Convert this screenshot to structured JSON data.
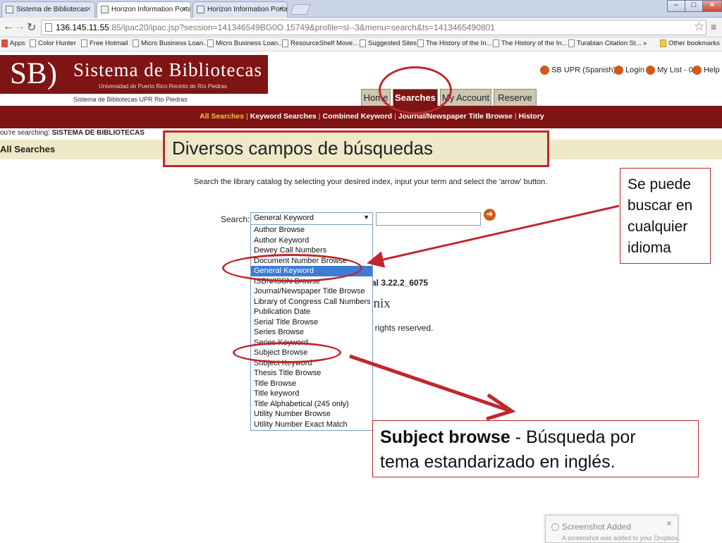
{
  "browser": {
    "tabs": [
      {
        "label": "Sistema de Bibliotecas"
      },
      {
        "label": "Horizon Information Porta"
      },
      {
        "label": "Horizon Information Porta"
      }
    ],
    "url_host": "136.145.11.55",
    "url_rest": ":85/ipac20/ipac.jsp?session=141346549BG0O.15749&profile=sl--3&menu=search&ts=1413465490801",
    "bookmarks": [
      "Apps",
      "Color Hunter",
      "Free Hotmail",
      "Micro Business Loan...",
      "Micro Business Loan...",
      "ResourceShelf Move...",
      "Suggested Sites",
      "The History of the In...",
      "The History of the In...",
      "Turabian Citation St...",
      "»",
      "Other bookmarks"
    ]
  },
  "library": {
    "logo_sb": "SB)",
    "logo_title": "Sistema de Bibliotecas",
    "logo_sub": "Universidad de Puerto Rico Recinto de Río Piedras",
    "logo_caption": "Sistema de Bibliotecas UPR Rio Piedras",
    "top_links": {
      "lang": "SB UPR (Spanish)",
      "login": "Login",
      "mylist": "My List - 0",
      "help": "Help"
    },
    "tabs": [
      "Home",
      "Searches",
      "My Account",
      "Reserve"
    ],
    "sublinks": [
      "All Searches",
      "Keyword Searches",
      "Combined Keyword",
      "Journal/Newspaper Title Browse",
      "History"
    ],
    "searching_prefix": "ou're searching:",
    "searching_value": "SISTEMA DE BIBLIOTECAS",
    "section_title": "All Searches",
    "instructions": "Search the library catalog by selecting your desired index, input your term and select the 'arrow' button.",
    "search_label": "Search:",
    "dropdown_selected": "General Keyword",
    "dropdown_options": [
      "Author Browse",
      "Author Keyword",
      "Dewey Call Numbers",
      "Document Number Browse",
      "General Keyword",
      "ISBN/ISSN Browse",
      "Journal/Newspaper Title Browse",
      "Library of Congress Call Numbers",
      "Publication Date",
      "Serial Title Browse",
      "Series Browse",
      "Series Keyword",
      "Subject Browse",
      "Subject Keyword",
      "Thesis Title Browse",
      "Title Browse",
      "Title keyword",
      "Title Alphabetical (245 only)",
      "Utility Number Browse",
      "Utility Number Exact Match"
    ],
    "dropdown_highlighted_index": 4,
    "behind_version": "tal 3.22.2_6075",
    "behind_logo": "ynix",
    "behind_rights": "ll rights reserved."
  },
  "annotations": {
    "title": "Diversos campos de búsquedas",
    "note1": [
      "Se puede",
      "buscar en",
      "cualquier",
      "idioma"
    ],
    "note2_bold": "Subject browse",
    "note2_rest": " - Búsqueda por",
    "note2_line2": "tema estandarizado en inglés.",
    "color": "#c0272d"
  },
  "toast": {
    "title": "Screenshot Added",
    "body": "A screenshot was added to your Dropbox."
  }
}
